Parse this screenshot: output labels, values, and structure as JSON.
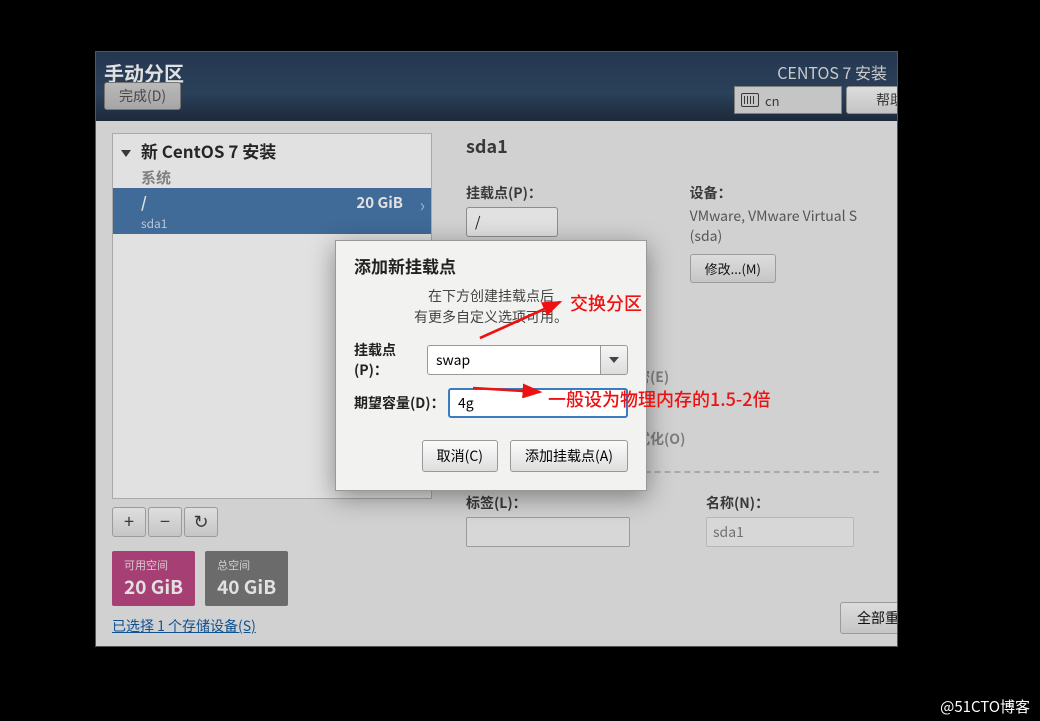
{
  "header": {
    "title": "手动分区",
    "done_button": "完成(D)",
    "installer_title": "CENTOS 7 安装",
    "lang_indicator": "cn",
    "help_button": "帮助"
  },
  "left": {
    "install_heading": "新 CentOS 7 安装",
    "system_label": "系统",
    "selected": {
      "mountpoint": "/",
      "size": "20 GiB",
      "device": "sda1"
    },
    "add_btn": "+",
    "remove_btn": "−",
    "space_avail_label": "可用空间",
    "space_avail_value": "20 GiB",
    "space_total_label": "总空间",
    "space_total_value": "40 GiB",
    "storage_link": "已选择 1 个存储设备(S)"
  },
  "right": {
    "title": "sda1",
    "mountpoint_label": "挂载点(P)：",
    "mountpoint_value": "/",
    "devices_label": "设备：",
    "devices_value": "VMware, VMware Virtual S (sda)",
    "modify_btn": "修改...(M)",
    "encrypt_hint": "密(E)",
    "reformat_hint": "式化(O)",
    "label_label": "标签(L)：",
    "name_label": "名称(N)：",
    "name_value": "sda1",
    "reset_btn": "全部重设"
  },
  "modal": {
    "title": "添加新挂载点",
    "note_line1": "在下方创建挂载点后",
    "note_line2": "有更多自定义选项可用。",
    "mountpoint_label": "挂载点(P)：",
    "mountpoint_value": "swap",
    "capacity_label": "期望容量(D)：",
    "capacity_value": "4g",
    "cancel_btn": "取消(C)",
    "add_btn": "添加挂载点(A)"
  },
  "annotations": {
    "swap_note": "交换分区",
    "mem_note": "一般设为物理内存的1.5-2倍"
  },
  "watermark": "@51CTO博客"
}
